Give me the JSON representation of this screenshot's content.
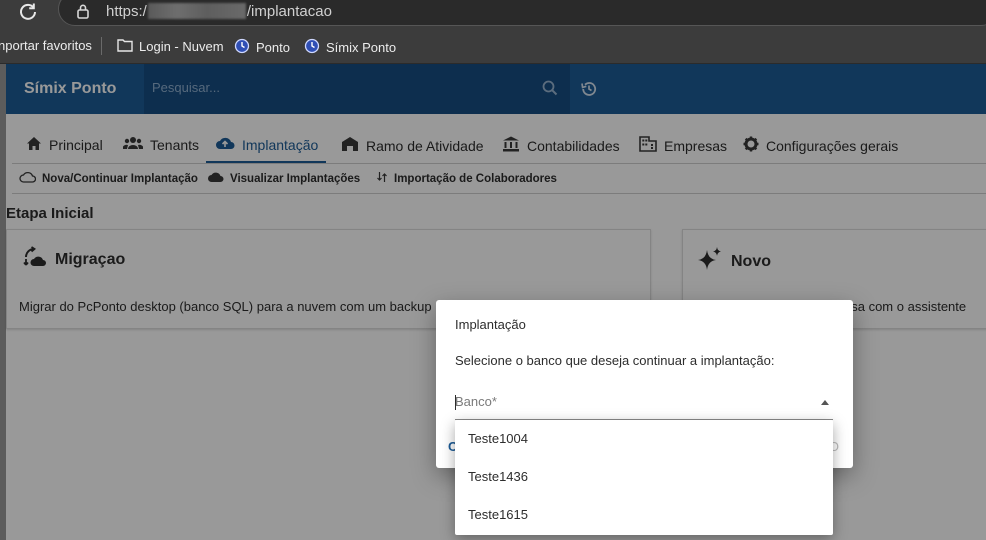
{
  "browser": {
    "url_prefix": "https:/",
    "url_suffix": "/implantacao",
    "bookmarks": [
      "nportar favoritos",
      "Login - Nuvem",
      "Ponto",
      "Símix Ponto"
    ]
  },
  "app": {
    "title": "Símix Ponto",
    "search_placeholder": "Pesquisar...",
    "tabs": [
      "Principal",
      "Tenants",
      "Implantação",
      "Ramo de Atividade",
      "Contabilidades",
      "Empresas",
      "Configurações gerais"
    ],
    "active_tab": "Implantação",
    "subtabs": [
      "Nova/Continuar Implantação",
      "Visualizar Implantações",
      "Importação de Colaboradores"
    ],
    "stage_title": "Etapa Inicial",
    "cards": [
      {
        "title": "Migraçao",
        "description": "Migrar do PcPonto desktop (banco SQL) para a nuvem com um backup"
      },
      {
        "title": "Novo",
        "description": "esa com o assistente"
      }
    ]
  },
  "dialog": {
    "title": "Implantação",
    "text": "Selecione o banco que deseja continuar a implantação:",
    "select_label": "Banco*",
    "btn_left_partial": "C",
    "btn_right_partial": "O",
    "options": [
      "Teste1004",
      "Teste1436",
      "Teste1615"
    ]
  },
  "colors": {
    "header": "#1d5c97",
    "accent": "#1d5c97"
  }
}
